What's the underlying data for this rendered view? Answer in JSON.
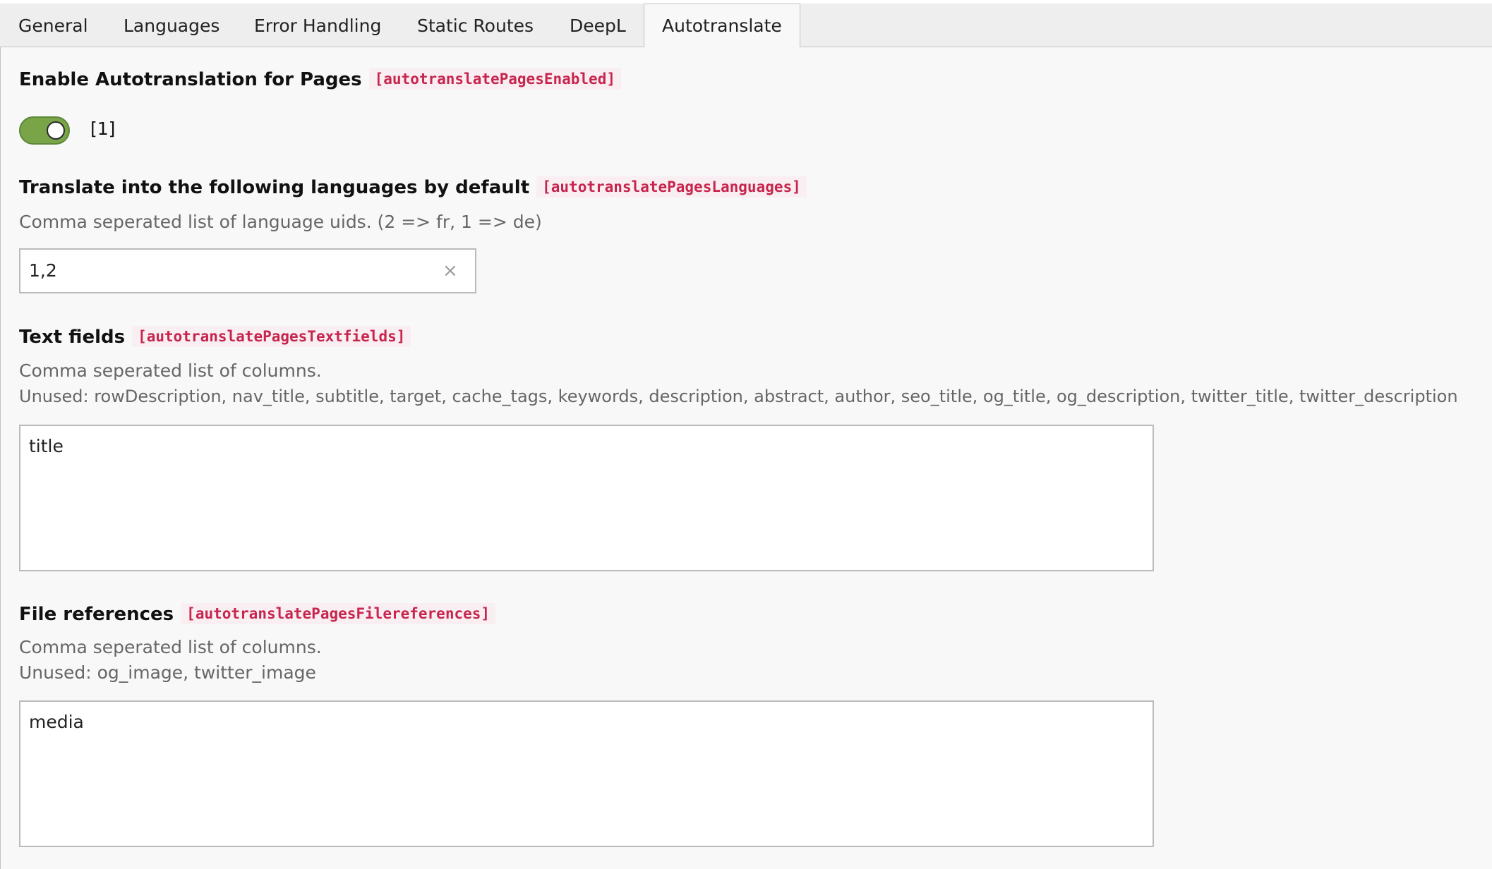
{
  "tabs": [
    {
      "label": "General"
    },
    {
      "label": "Languages"
    },
    {
      "label": "Error Handling"
    },
    {
      "label": "Static Routes"
    },
    {
      "label": "DeepL"
    },
    {
      "label": "Autotranslate",
      "active": true
    }
  ],
  "fields": {
    "enabled": {
      "label": "Enable Autotranslation for Pages",
      "key": "[autotranslatePagesEnabled]",
      "value": "[1]",
      "checked": true
    },
    "languages": {
      "label": "Translate into the following languages by default",
      "key": "[autotranslatePagesLanguages]",
      "description": "Comma seperated list of language uids. (2 => fr, 1 => de)",
      "value": "1,2",
      "clear_icon": "×"
    },
    "textfields": {
      "label": "Text fields",
      "key": "[autotranslatePagesTextfields]",
      "description": "Comma seperated list of columns.",
      "unused": "Unused: rowDescription, nav_title, subtitle, target, cache_tags, keywords, description, abstract, author, seo_title, og_title, og_description, twitter_title, twitter_description",
      "value": "title"
    },
    "filereferences": {
      "label": "File references",
      "key": "[autotranslatePagesFilereferences]",
      "description": "Comma seperated list of columns.",
      "unused": "Unused: og_image, twitter_image",
      "value": "media"
    }
  },
  "colors": {
    "toggle_on": "#79a548",
    "code_text": "#c7254e",
    "code_bg": "#f9eef1"
  }
}
